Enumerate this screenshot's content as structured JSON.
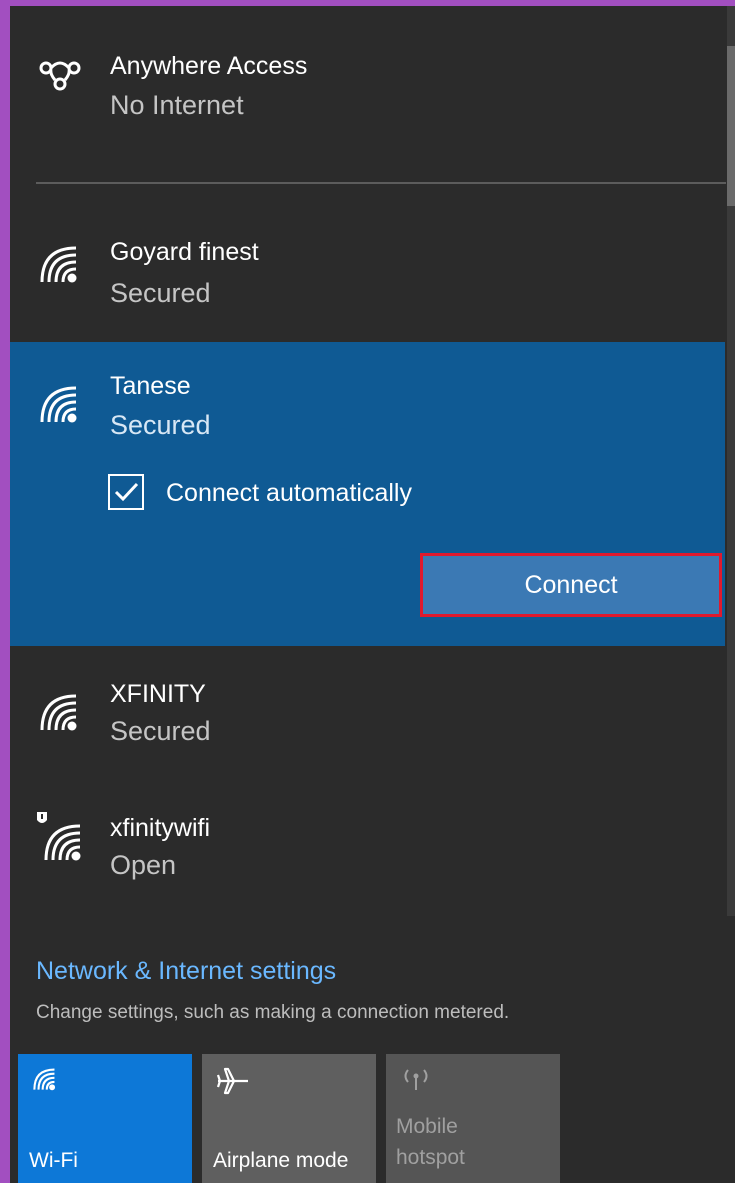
{
  "networks": [
    {
      "name": "Anywhere Access",
      "status": "No Internet"
    },
    {
      "name": "Goyard finest",
      "status": "Secured"
    },
    {
      "name": "Tanese",
      "status": "Secured"
    },
    {
      "name": "XFINITY",
      "status": "Secured"
    },
    {
      "name": "xfinitywifi",
      "status": "Open"
    }
  ],
  "selected": {
    "connect_automatically_label": "Connect automatically",
    "connect_automatically_checked": true,
    "connect_button_label": "Connect"
  },
  "settings": {
    "link_label": "Network & Internet settings",
    "description": "Change settings, such as making a connection metered."
  },
  "quick_actions": [
    {
      "label": "Wi-Fi",
      "icon": "wifi-icon",
      "active": true
    },
    {
      "label": "Airplane mode",
      "icon": "airplane-icon",
      "active": false
    },
    {
      "label_line1": "Mobile",
      "label_line2": "hotspot",
      "icon": "mobile-hotspot-icon",
      "active": false
    }
  ],
  "colors": {
    "panel_bg": "#2b2b2b",
    "selected_bg": "#0f5a94",
    "accent": "#0d78d7",
    "link": "#6ab8ff",
    "highlight_border": "#e0192e"
  }
}
